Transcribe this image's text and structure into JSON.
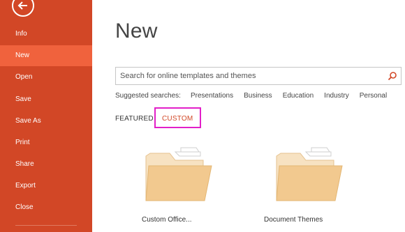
{
  "sidebar": {
    "back_icon": "back-arrow-icon",
    "items": [
      {
        "label": "Info"
      },
      {
        "label": "New",
        "selected": true
      },
      {
        "label": "Open"
      },
      {
        "label": "Save"
      },
      {
        "label": "Save As"
      },
      {
        "label": "Print"
      },
      {
        "label": "Share"
      },
      {
        "label": "Export"
      },
      {
        "label": "Close"
      }
    ],
    "colors": {
      "background": "#d24726",
      "selected": "#f0623d"
    }
  },
  "main": {
    "title": "New",
    "search": {
      "placeholder": "Search for online templates and themes",
      "icon": "search-icon"
    },
    "suggested": {
      "label": "Suggested searches:",
      "links": [
        "Presentations",
        "Business",
        "Education",
        "Industry",
        "Personal"
      ]
    },
    "tabs": {
      "featured": "FEATURED",
      "custom": "CUSTOM",
      "active": "custom"
    },
    "tiles": [
      {
        "label": "Custom Office...",
        "icon": "folder-icon"
      },
      {
        "label": "Document Themes",
        "icon": "folder-icon"
      }
    ],
    "colors": {
      "accent": "#d24726",
      "highlight": "#e21fc8",
      "folder": "#f2c98f"
    }
  }
}
